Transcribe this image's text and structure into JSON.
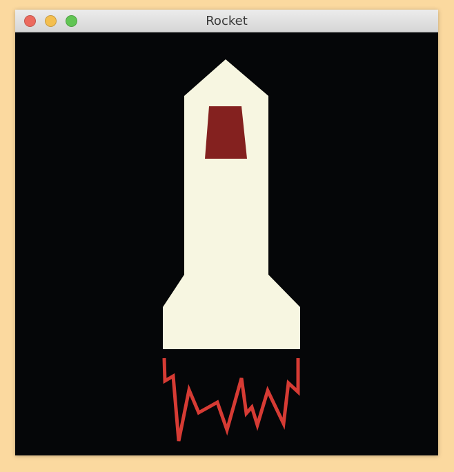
{
  "window": {
    "title": "Rocket",
    "buttons": {
      "close": {
        "icon": "close-circle-icon",
        "color": "#ec6a5e"
      },
      "minimize": {
        "icon": "minimize-circle-icon",
        "color": "#f4bf4f"
      },
      "maximize": {
        "icon": "maximize-circle-icon",
        "color": "#61c554"
      }
    }
  },
  "colors": {
    "page_background": "#fbd99f",
    "canvas_background": "#050608",
    "rocket_body": "#f7f6e1",
    "rocket_window": "#84211f",
    "flame": "#d63b34"
  }
}
